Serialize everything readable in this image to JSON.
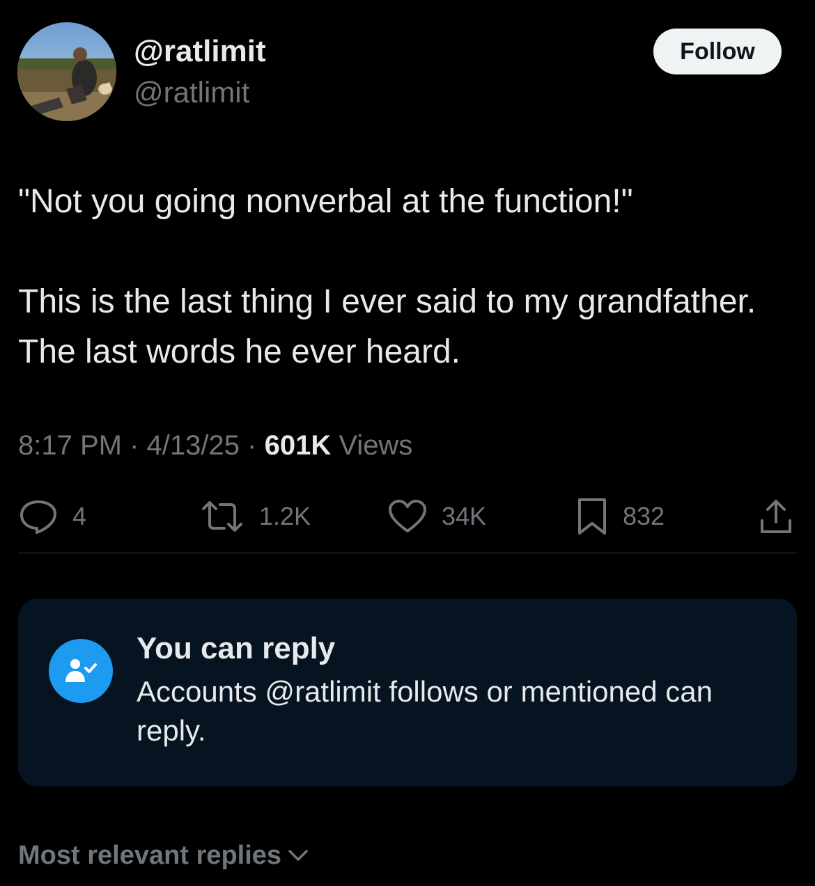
{
  "author": {
    "display_name": "@ratlimit",
    "handle": "@ratlimit",
    "avatar_icon": "profile-photo-avatar"
  },
  "follow_label": "Follow",
  "tweet": {
    "paragraph_1": "\"Not you going nonverbal at the function!\"",
    "paragraph_2": "This is the last thing I ever said to my grandfather. The last words he ever heard."
  },
  "meta": {
    "time": "8:17 PM",
    "separator": "·",
    "date": "4/13/25",
    "views_count": "601K",
    "views_label": "Views"
  },
  "actions": {
    "replies": "4",
    "reposts": "1.2K",
    "likes": "34K",
    "bookmarks": "832"
  },
  "reply_card": {
    "title": "You can reply",
    "description": "Accounts @ratlimit follows or mentioned can reply.",
    "icon": "person-check-icon"
  },
  "sort_label": "Most relevant replies",
  "colors": {
    "background": "#000000",
    "text_primary": "#e7e9ea",
    "text_secondary": "#71767b",
    "accent_blue": "#1d9bf0",
    "card_background": "#061422",
    "follow_button_bg": "#eff3f4"
  }
}
